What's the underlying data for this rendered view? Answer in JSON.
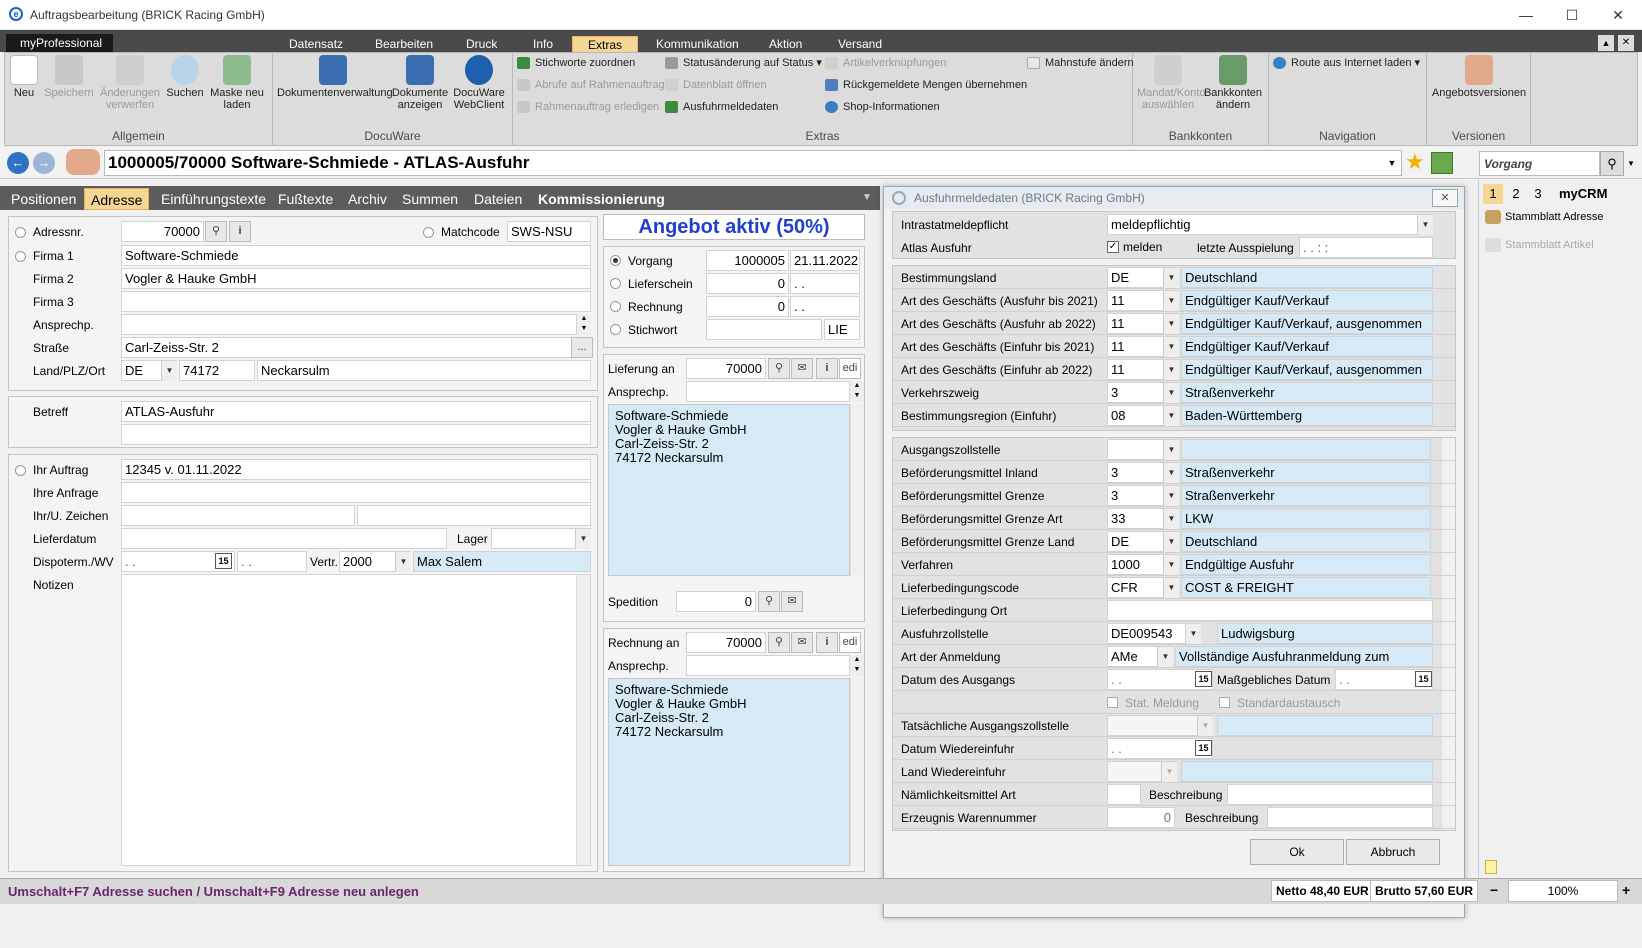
{
  "window": {
    "title": "Auftragsbearbeitung (BRICK Racing GmbH)"
  },
  "ribbon": {
    "app_tab": "myProfessional",
    "tabs": [
      "Datensatz",
      "Bearbeiten",
      "Druck",
      "Info",
      "Extras",
      "Kommunikation",
      "Aktion",
      "Versand"
    ],
    "active_tab": "Extras",
    "groups": {
      "allgemein": "Allgemein",
      "docuware": "DocuWare",
      "extras": "Extras",
      "bankkonten": "Bankkonten",
      "navigation": "Navigation",
      "versionen": "Versionen"
    },
    "allgemein": [
      "Neu",
      "Speichern",
      "Änderungen verwerfen",
      "Suchen",
      "Maske neu laden"
    ],
    "docuware": [
      "Dokumentenverwaltung",
      "Dokumente anzeigen",
      "DocuWare WebClient"
    ],
    "extras_col1": [
      "Stichworte zuordnen",
      "Abrufe auf Rahmenauftrag",
      "Rahmenauftrag erledigen"
    ],
    "extras_col2": [
      "Statusänderung auf Status",
      "Datenblatt öffnen",
      "Ausfuhrmeldedaten"
    ],
    "extras_col3": [
      "Artikelverknüpfungen",
      "Rückgemeldete Mengen übernehmen",
      "Shop-Informationen"
    ],
    "extras_col4": [
      "Mahnstufe ändern"
    ],
    "bankkonten": [
      "Mandat/Konto auswählen",
      "Bankkonten ändern"
    ],
    "navigation": [
      "Route aus Internet laden"
    ],
    "versionen": [
      "Angebotsversionen"
    ]
  },
  "nav": {
    "doc_id": "1000005/70000  Software-Schmiede - ATLAS-Ausfuhr",
    "vorgang": "Vorgang"
  },
  "tabs": [
    "Positionen",
    "Adresse",
    "Einführungstexte",
    "Fußtexte",
    "Archiv",
    "Summen",
    "Dateien",
    "Kommissionierung"
  ],
  "address": {
    "adressnr_label": "Adressnr.",
    "adressnr": "70000",
    "matchcode_label": "Matchcode",
    "matchcode": "SWS-NSU",
    "firma1_label": "Firma 1",
    "firma1": "Software-Schmiede",
    "firma2_label": "Firma 2",
    "firma2": "Vogler & Hauke GmbH",
    "firma3_label": "Firma 3",
    "firma3": "",
    "ansprech_label": "Ansprechp.",
    "ansprech": "",
    "strasse_label": "Straße",
    "strasse": "Carl-Zeiss-Str. 2",
    "land_label": "Land/PLZ/Ort",
    "land": "DE",
    "plz": "74172",
    "ort": "Neckarsulm",
    "betreff_label": "Betreff",
    "betreff": "ATLAS-Ausfuhr",
    "auftrag_label": "Ihr Auftrag",
    "auftrag": "12345 v. 01.11.2022",
    "anfrage_label": "Ihre Anfrage",
    "zeichen_label": "Ihr/U. Zeichen",
    "lieferdatum_label": "Lieferdatum",
    "lager_label": "Lager",
    "dispo_label": "Dispoterm./WV",
    "dispo1": ". .",
    "dispo2": ". .",
    "vertr_label": "Vertr.",
    "vertr": "2000",
    "vertr_name": "Max Salem",
    "notizen_label": "Notizen"
  },
  "offer": {
    "banner": "Angebot aktiv (50%)",
    "vorgang_label": "Vorgang",
    "vorgang": "1000005",
    "vorgang_date": "21.11.2022",
    "lieferschein_label": "Lieferschein",
    "lieferschein": "0",
    "lieferschein_date": ". .",
    "rechnung_label": "Rechnung",
    "rechnung": "0",
    "rechnung_date": ". .",
    "stichwort_label": "Stichwort",
    "stichwort": "LIE",
    "lieferung_label": "Lieferung an",
    "lieferung": "70000",
    "ansprech_label": "Ansprechp.",
    "lieferung_addr": [
      "Software-Schmiede",
      "Vogler & Hauke GmbH",
      "Carl-Zeiss-Str. 2",
      "74172 Neckarsulm"
    ],
    "spedition_label": "Spedition",
    "spedition": "0",
    "rechnung_an_label": "Rechnung an",
    "rechnung_an": "70000",
    "rechnung_addr": [
      "Software-Schmiede",
      "Vogler & Hauke GmbH",
      "Carl-Zeiss-Str. 2",
      "74172 Neckarsulm"
    ],
    "edi": "edi"
  },
  "dialog": {
    "title": "Ausfuhrmeldedaten (BRICK Racing GmbH)",
    "intrastat_label": "Intrastatmeldepflicht",
    "intrastat": "meldepflichtig",
    "atlas_label": "Atlas Ausfuhr",
    "melden": "melden",
    "letzte_label": "letzte Ausspielung",
    "letzte": ". .   : :",
    "sec2": [
      {
        "label": "Bestimmungsland",
        "code": "DE",
        "text": "Deutschland"
      },
      {
        "label": "Art des Geschäfts (Ausfuhr bis 2021)",
        "code": "11",
        "text": "Endgültiger Kauf/Verkauf"
      },
      {
        "label": "Art des Geschäfts (Ausfuhr ab 2022)",
        "code": "11",
        "text": "Endgültiger Kauf/Verkauf, ausgenommen"
      },
      {
        "label": "Art des Geschäfts (Einfuhr bis 2021)",
        "code": "11",
        "text": "Endgültiger Kauf/Verkauf"
      },
      {
        "label": "Art des Geschäfts (Einfuhr ab 2022)",
        "code": "11",
        "text": "Endgültiger Kauf/Verkauf, ausgenommen"
      },
      {
        "label": "Verkehrszweig",
        "code": "3",
        "text": "Straßenverkehr"
      },
      {
        "label": "Bestimmungsregion (Einfuhr)",
        "code": "08",
        "text": "Baden-Württemberg"
      }
    ],
    "sec3": [
      {
        "label": "Ausgangszollstelle",
        "code": "",
        "text": ""
      },
      {
        "label": "Beförderungsmittel Inland",
        "code": "3",
        "text": "Straßenverkehr"
      },
      {
        "label": "Beförderungsmittel Grenze",
        "code": "3",
        "text": "Straßenverkehr"
      },
      {
        "label": "Beförderungsmittel Grenze Art",
        "code": "33",
        "text": "LKW"
      },
      {
        "label": "Beförderungsmittel Grenze Land",
        "code": "DE",
        "text": "Deutschland"
      },
      {
        "label": "Verfahren",
        "code": "1000",
        "text": "Endgültige Ausfuhr"
      },
      {
        "label": "Lieferbedingungscode",
        "code": "CFR",
        "text": "COST & FREIGHT"
      }
    ],
    "lieferort_label": "Lieferbedingung Ort",
    "ausfuhrzoll_label": "Ausfuhrzollstelle",
    "ausfuhrzoll": "DE009543",
    "ausfuhrzoll_text": "Ludwigsburg",
    "anmeldung_label": "Art der Anmeldung",
    "anmeldung": "AMe",
    "anmeldung_text": "Vollständige Ausfuhranmeldung zum",
    "datum_ausgang_label": "Datum des Ausgangs",
    "datum_ausgang": ". .",
    "massgeb_label": "Maßgebliches Datum",
    "massgeb": ". .",
    "stat_meldung": "Stat. Meldung",
    "standardaustausch": "Standardaustausch",
    "tats_label": "Tatsächliche Ausgangszollstelle",
    "wiedereinfuhr_label": "Datum Wiedereinfuhr",
    "wiedereinfuhr": ". .",
    "land_wieder_label": "Land Wiedereinfuhr",
    "naemlich_label": "Nämlichkeitsmittel Art",
    "beschreibung": "Beschreibung",
    "erzeugnis_label": "Erzeugnis Warennummer",
    "erzeugnis": "0",
    "ok": "Ok",
    "abbruch": "Abbruch"
  },
  "right": {
    "tabs": [
      "1",
      "2",
      "3"
    ],
    "mycrm": "myCRM",
    "items": [
      "Stammblatt Adresse",
      "Stammblatt Artikel"
    ]
  },
  "status": {
    "hint": "Umschalt+F7 Adresse suchen / Umschalt+F9 Adresse neu anlegen",
    "netto": "Netto 48,40 EUR",
    "brutto": "Brutto 57,60 EUR",
    "zoom": "100%"
  }
}
